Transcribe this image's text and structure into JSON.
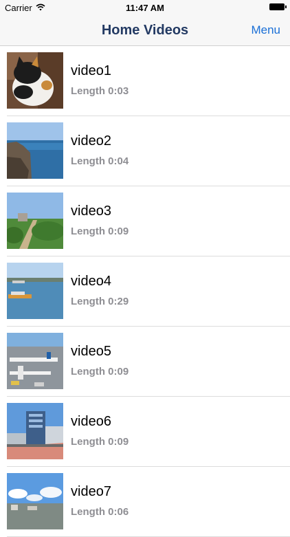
{
  "status": {
    "carrier": "Carrier",
    "time": "11:47 AM"
  },
  "nav": {
    "title": "Home Videos",
    "menu": "Menu"
  },
  "videos": [
    {
      "title": "video1",
      "length": "Length 0:03",
      "thumb": "cat"
    },
    {
      "title": "video2",
      "length": "Length 0:04",
      "thumb": "coast"
    },
    {
      "title": "video3",
      "length": "Length 0:09",
      "thumb": "path"
    },
    {
      "title": "video4",
      "length": "Length 0:29",
      "thumb": "harbor"
    },
    {
      "title": "video5",
      "length": "Length 0:09",
      "thumb": "airport"
    },
    {
      "title": "video6",
      "length": "Length 0:09",
      "thumb": "building"
    },
    {
      "title": "video7",
      "length": "Length 0:06",
      "thumb": "sky"
    }
  ]
}
